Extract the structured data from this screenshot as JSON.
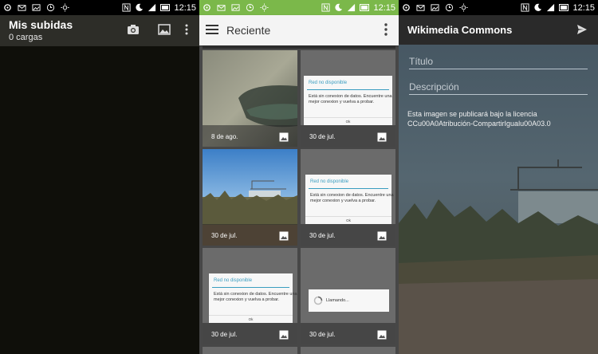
{
  "statusbar": {
    "time": "12:15"
  },
  "panel1": {
    "title": "Mis subidas",
    "subtitle": "0 cargas"
  },
  "panel2": {
    "title": "Reciente",
    "tiles": [
      {
        "date": "8 de ago."
      },
      {
        "date": "30 de jul."
      },
      {
        "date": "30 de jul."
      },
      {
        "date": "30 de jul."
      },
      {
        "date": "30 de jul."
      },
      {
        "date": "30 de jul."
      }
    ],
    "dialog": {
      "title": "Red no disponible",
      "message": "Está sin conexion de datos. Encuentre una mejor conexion y vuelva a probar.",
      "ok": "Ok",
      "loading": "Llamando..."
    }
  },
  "panel3": {
    "title": "Wikimedia Commons",
    "title_placeholder": "Título",
    "description_placeholder": "Descripción",
    "license_line1": "Esta imagen se publicará bajo la licencia",
    "license_line2": "CCu00A0Atribución-CompartirIgualu00A03.0"
  },
  "colors": {
    "accent_green": "#7bb84a",
    "dialog_blue": "#3a9dc0"
  },
  "icons": [
    "camera-icon",
    "gallery-icon",
    "overflow-menu-icon",
    "hamburger-menu-icon",
    "send-icon",
    "image-icon"
  ]
}
